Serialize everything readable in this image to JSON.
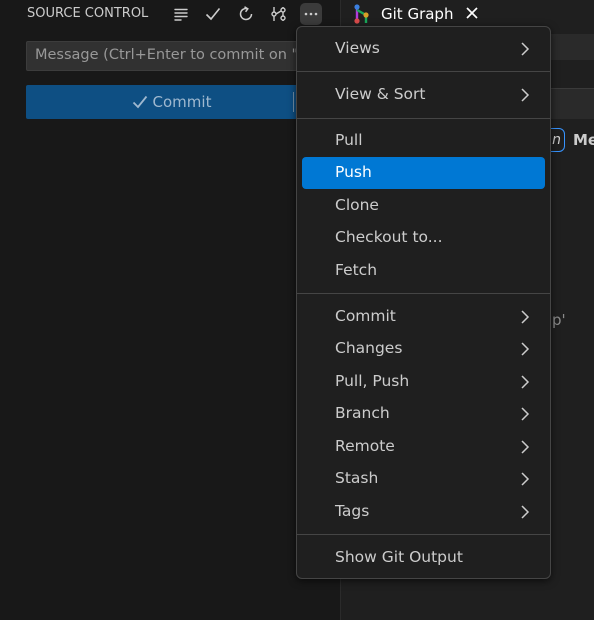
{
  "source_control": {
    "title": "SOURCE CONTROL",
    "message_placeholder": "Message (Ctrl+Enter to commit on \"...",
    "commit_label": "Commit"
  },
  "tab": {
    "label": "Git Graph"
  },
  "background_fragments": {
    "pill_text": "n",
    "column_text": "Me",
    "partial_text": "p'"
  },
  "menu": {
    "items": [
      {
        "label": "Views"
      },
      {
        "label": "View & Sort"
      },
      {
        "label": "Pull"
      },
      {
        "label": "Push"
      },
      {
        "label": "Clone"
      },
      {
        "label": "Checkout to..."
      },
      {
        "label": "Fetch"
      },
      {
        "label": "Commit"
      },
      {
        "label": "Changes"
      },
      {
        "label": "Pull, Push"
      },
      {
        "label": "Branch"
      },
      {
        "label": "Remote"
      },
      {
        "label": "Stash"
      },
      {
        "label": "Tags"
      },
      {
        "label": "Show Git Output"
      }
    ],
    "selected": "Push"
  },
  "colors": {
    "accent": "#0078d4",
    "commit_button": "#0e4f83",
    "background": "#181818",
    "menu_background": "#1f1f1f"
  },
  "icons": [
    "view-as-list-icon",
    "checkmark-icon",
    "refresh-icon",
    "git-graph-icon",
    "more-actions-icon",
    "git-graph-tab-icon",
    "close-icon",
    "chevron-right-icon"
  ]
}
